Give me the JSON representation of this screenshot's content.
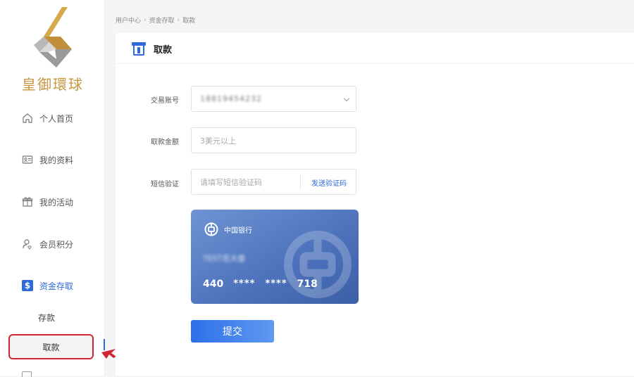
{
  "brand": {
    "name": "皇御環球",
    "gold": "#c7963f"
  },
  "sidebar": {
    "items": [
      {
        "label": "个人首页",
        "icon": "home-icon"
      },
      {
        "label": "我的资料",
        "icon": "id-card-icon"
      },
      {
        "label": "我的活动",
        "icon": "gift-icon"
      },
      {
        "label": "会员积分",
        "icon": "member-points-icon"
      },
      {
        "label": "资金存取",
        "icon": "dollar-icon",
        "active": true
      }
    ],
    "sub_items": [
      {
        "label": "存款"
      },
      {
        "label": "取款",
        "selected": true
      }
    ]
  },
  "breadcrumb": [
    "用户中心",
    "资金存取",
    "取款"
  ],
  "page": {
    "title": "取款"
  },
  "form": {
    "account_label": "交易账号",
    "account_value": "18819454232",
    "amount_label": "取款金额",
    "amount_placeholder": "3美元以上",
    "sms_label": "短信验证",
    "sms_placeholder": "请填写短信验证码",
    "sms_button": "发送验证码"
  },
  "bank_card": {
    "bank_name": "中国银行",
    "holder": "TEST花大查",
    "number_start": "440",
    "mask1": "****",
    "mask2": "****",
    "number_end": "718"
  },
  "submit_label": "提交",
  "colors": {
    "accent": "#2d6bda",
    "highlight": "#d0262f"
  }
}
